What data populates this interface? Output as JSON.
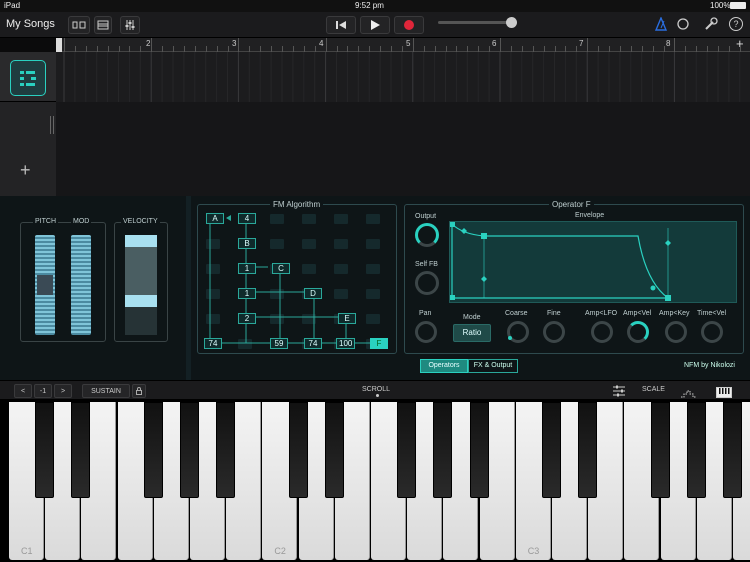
{
  "status": {
    "device": "iPad",
    "time": "9:52 pm",
    "battery": "100%"
  },
  "toolbar": {
    "back_label": "My Songs",
    "icons": [
      "rewind-icon",
      "play-icon",
      "record-icon",
      "metronome-icon",
      "loop-icon",
      "wrench-icon",
      "help-icon"
    ],
    "record_color": "#e0263a",
    "accent": "#2ad1c0"
  },
  "ruler": {
    "bars": [
      "2",
      "3",
      "4",
      "5",
      "6",
      "7",
      "8"
    ]
  },
  "pads": {
    "pitch_label": "PITCH",
    "mod_label": "MOD",
    "velocity_label": "VELOCITY"
  },
  "fm": {
    "title": "FM Algorithm",
    "ops": [
      "A",
      "4",
      "B",
      "1",
      "C",
      "1",
      "D",
      "2",
      "E",
      "F"
    ],
    "bottom_values": [
      "74",
      "59",
      "74",
      "100"
    ]
  },
  "operator": {
    "title": "Operator F",
    "output_label": "Output",
    "selffb_label": "Self FB",
    "envelope_label": "Envelope",
    "pan_label": "Pan",
    "mode_label": "Mode",
    "mode_value": "Ratio",
    "coarse_label": "Coarse",
    "fine_label": "Fine",
    "amplfo_label": "Amp<LFO",
    "ampvel_label": "Amp<Vel",
    "ampkey_label": "Amp<Key",
    "timevel_label": "Time<Vel"
  },
  "tabs": {
    "operators": "Operators",
    "fx": "FX & Output"
  },
  "credit": "NFM by Nikolozi",
  "kbbar": {
    "prev": "<",
    "octave": "-1",
    "next": ">",
    "sustain": "SUSTAIN",
    "scroll": "SCROLL",
    "scale": "SCALE"
  },
  "keys": {
    "c1": "C1",
    "c2": "C2",
    "c3": "C3"
  }
}
